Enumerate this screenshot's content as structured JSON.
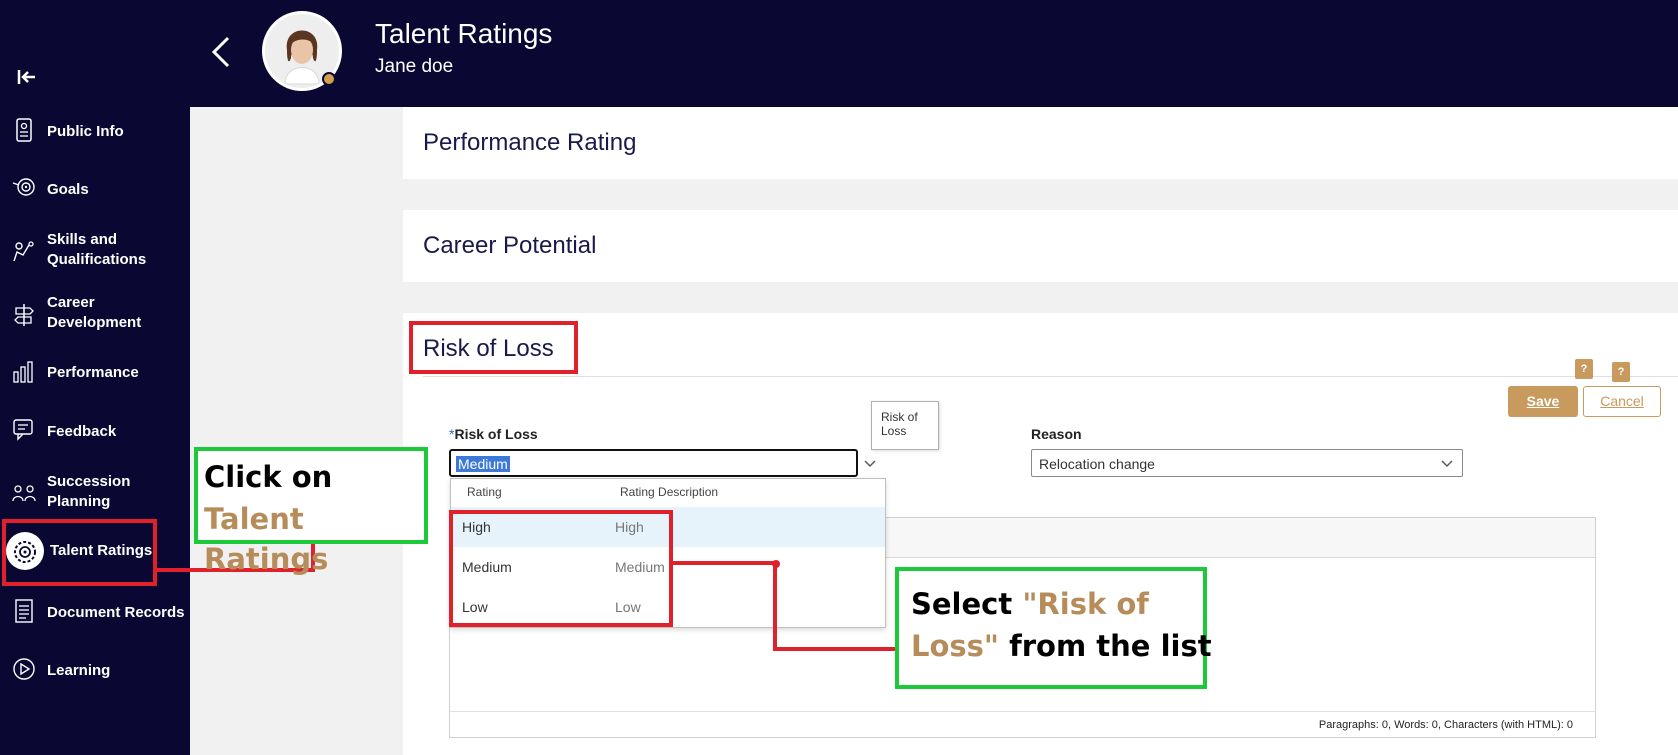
{
  "header": {
    "title": "Talent Ratings",
    "subtitle": "Jane doe"
  },
  "sidebar": {
    "items": [
      {
        "label": "Public Info",
        "icon": "id-card-icon"
      },
      {
        "label": "Goals",
        "icon": "target-icon"
      },
      {
        "label": "Skills and Qualifications",
        "icon": "skills-icon"
      },
      {
        "label": "Career Development",
        "icon": "signpost-icon"
      },
      {
        "label": "Performance",
        "icon": "bar-chart-icon"
      },
      {
        "label": "Feedback",
        "icon": "feedback-icon"
      },
      {
        "label": "Succession Planning",
        "icon": "people-icon"
      },
      {
        "label": "Talent Ratings",
        "icon": "talent-icon",
        "active": true
      },
      {
        "label": "Document Records",
        "icon": "document-icon"
      },
      {
        "label": "Learning",
        "icon": "play-circle-icon"
      }
    ]
  },
  "panels": {
    "performance": "Performance Rating",
    "career": "Career Potential",
    "risk": "Risk of Loss"
  },
  "form": {
    "help1": "?",
    "help2": "?",
    "save": "Save",
    "cancel": "Cancel",
    "risk_label": "Risk of Loss",
    "risk_required": "*",
    "risk_value": "Medium",
    "tooltip": "Risk of Loss",
    "reason_label": "Reason",
    "reason_value": "Relocation change"
  },
  "dropdown": {
    "col_rating": "Rating",
    "col_desc": "Rating Description",
    "options": [
      {
        "rating": "High",
        "desc": "High"
      },
      {
        "rating": "Medium",
        "desc": "Medium"
      },
      {
        "rating": "Low",
        "desc": "Low"
      }
    ]
  },
  "editor": {
    "count": "Paragraphs: 0, Words: 0, Characters (with HTML): 0"
  },
  "annotations": {
    "click_on": "Click on",
    "talent_ratings": "Talent Ratings",
    "select": "Select ",
    "risk_quote1": "\"Risk of",
    "risk_quote2": "Loss\"",
    "from_list": " from the list"
  },
  "colors": {
    "navy": "#0a0833",
    "gold": "#c99a5d",
    "annotation_red": "#e0212b",
    "annotation_green": "#1cc93b"
  }
}
